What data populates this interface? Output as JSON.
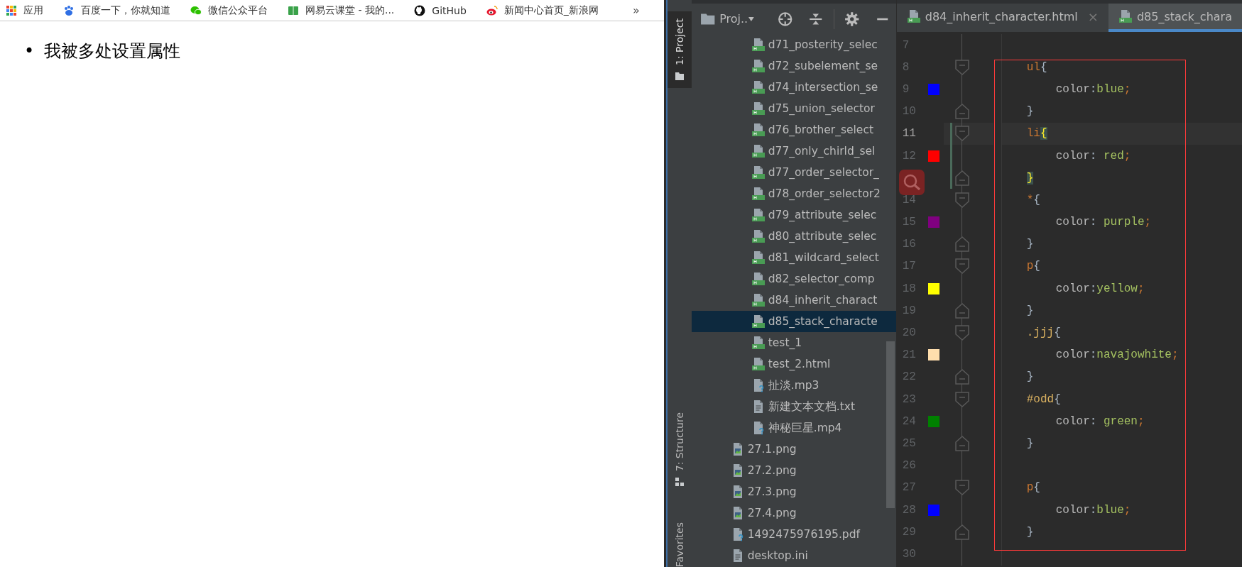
{
  "browser": {
    "bookmarks": [
      {
        "label": "应用",
        "kind": "apps"
      },
      {
        "label": "百度一下，你就知道",
        "kind": "paw"
      },
      {
        "label": "微信公众平台",
        "kind": "chat"
      },
      {
        "label": "网易云课堂 - 我的...",
        "kind": "book"
      },
      {
        "label": "GitHub",
        "kind": "github"
      },
      {
        "label": "新闻中心首页_新浪网",
        "kind": "weibo"
      }
    ],
    "overflow": "»",
    "list_items": [
      {
        "bullet": "•",
        "text": "我被多处设置属性"
      }
    ]
  },
  "ide": {
    "tool_tabs": [
      {
        "label": "1: Project",
        "selected": true,
        "kind": "project"
      },
      {
        "label": "7: Structure",
        "selected": false,
        "kind": "structure"
      },
      {
        "label": "Favorites",
        "selected": false,
        "kind": "favorites"
      }
    ],
    "project": {
      "title": "Proj..",
      "tree": [
        {
          "children": [
            {
              "label": "d71_posterity_selec",
              "kind": "html",
              "selected": false
            },
            {
              "label": "d72_subelement_se",
              "kind": "html",
              "selected": false
            },
            {
              "label": "d74_intersection_se",
              "kind": "html",
              "selected": false
            },
            {
              "label": "d75_union_selector",
              "kind": "html",
              "selected": false
            },
            {
              "label": "d76_brother_select",
              "kind": "html",
              "selected": false
            },
            {
              "label": "d77_only_chirld_sel",
              "kind": "html",
              "selected": false
            },
            {
              "label": "d77_order_selector_",
              "kind": "html",
              "selected": false
            },
            {
              "label": "d78_order_selector2",
              "kind": "html",
              "selected": false
            },
            {
              "label": "d79_attribute_selec",
              "kind": "html",
              "selected": false
            },
            {
              "label": "d80_attribute_selec",
              "kind": "html",
              "selected": false
            },
            {
              "label": "d81_wildcard_select",
              "kind": "html",
              "selected": false
            },
            {
              "label": "d82_selector_comp",
              "kind": "html",
              "selected": false
            },
            {
              "label": "d84_inherit_charact",
              "kind": "html",
              "selected": false
            },
            {
              "label": "d85_stack_characte",
              "kind": "html",
              "selected": true
            },
            {
              "label": "test_1",
              "kind": "html",
              "selected": false
            },
            {
              "label": "test_2.html",
              "kind": "html",
              "selected": false
            },
            {
              "label": "扯淡.mp3",
              "kind": "unknown",
              "selected": false
            },
            {
              "label": "新建文本文档.txt",
              "kind": "text",
              "selected": false
            },
            {
              "label": "神秘巨星.mp4",
              "kind": "unknown",
              "selected": false
            }
          ]
        },
        {
          "label": "27.1.png",
          "kind": "image",
          "selected": false
        },
        {
          "label": "27.2.png",
          "kind": "image",
          "selected": false
        },
        {
          "label": "27.3.png",
          "kind": "image",
          "selected": false
        },
        {
          "label": "27.4.png",
          "kind": "image",
          "selected": false
        },
        {
          "label": "1492475976195.pdf",
          "kind": "unknown",
          "selected": false
        },
        {
          "label": "desktop.ini",
          "kind": "text",
          "selected": false
        }
      ]
    },
    "editor_tabs": [
      {
        "label": "d84_inherit_character.html",
        "selected": false,
        "close": "×"
      },
      {
        "label": "d85_stack_chara",
        "selected": true
      }
    ],
    "lines": [
      {
        "num": "7",
        "kind": "blank",
        "fold_start": false,
        "fold_end": false,
        "current": false,
        "modified": false
      },
      {
        "num": "8",
        "kind": "selector",
        "fold_start": true,
        "fold_end": false,
        "current": false,
        "modified": false,
        "tokens": [
          {
            "text": "ul",
            "kind": "tag"
          },
          {
            "text": "{",
            "kind": "brace"
          }
        ]
      },
      {
        "num": "9",
        "kind": "decl",
        "color": "#0000ff",
        "fold_start": false,
        "fold_end": false,
        "current": false,
        "modified": false,
        "tokens": [
          {
            "text": "color",
            "kind": "prop"
          },
          {
            "text": ":",
            "kind": "punct"
          },
          {
            "text": "blue",
            "kind": "value"
          },
          {
            "text": ";",
            "kind": "semi"
          }
        ]
      },
      {
        "num": "10",
        "kind": "close",
        "fold_start": false,
        "fold_end": true,
        "current": false,
        "modified": false,
        "tokens": [
          {
            "text": "}",
            "kind": "brace"
          }
        ]
      },
      {
        "num": "11",
        "kind": "selector",
        "fold_start": true,
        "fold_end": false,
        "current": true,
        "modified": true,
        "tokens": [
          {
            "text": "li",
            "kind": "tag"
          },
          {
            "text": "{",
            "kind": "matched"
          }
        ]
      },
      {
        "num": "12",
        "kind": "decl",
        "color": "#ff0000",
        "fold_start": false,
        "fold_end": false,
        "current": false,
        "modified": true,
        "tokens": [
          {
            "text": "color",
            "kind": "prop"
          },
          {
            "text": ": ",
            "kind": "punct"
          },
          {
            "text": "red",
            "kind": "value"
          },
          {
            "text": ";",
            "kind": "semi"
          }
        ]
      },
      {
        "kind": "close",
        "fold_start": false,
        "fold_end": true,
        "current": false,
        "modified": true,
        "tokens": [
          {
            "text": "}",
            "kind": "matched"
          }
        ]
      },
      {
        "num": "14",
        "kind": "selector",
        "fold_start": true,
        "fold_end": false,
        "current": false,
        "modified": false,
        "tokens": [
          {
            "text": "*",
            "kind": "tag"
          },
          {
            "text": "{",
            "kind": "brace"
          }
        ]
      },
      {
        "num": "15",
        "kind": "decl",
        "color": "#800080",
        "fold_start": false,
        "fold_end": false,
        "current": false,
        "modified": false,
        "tokens": [
          {
            "text": "color",
            "kind": "prop"
          },
          {
            "text": ": ",
            "kind": "punct"
          },
          {
            "text": "purple",
            "kind": "value"
          },
          {
            "text": ";",
            "kind": "semi"
          }
        ]
      },
      {
        "num": "16",
        "kind": "close",
        "fold_start": false,
        "fold_end": true,
        "current": false,
        "modified": false,
        "tokens": [
          {
            "text": "}",
            "kind": "brace"
          }
        ]
      },
      {
        "num": "17",
        "kind": "selector",
        "fold_start": true,
        "fold_end": false,
        "current": false,
        "modified": false,
        "tokens": [
          {
            "text": "p",
            "kind": "tag"
          },
          {
            "text": "{",
            "kind": "brace"
          }
        ]
      },
      {
        "num": "18",
        "kind": "decl",
        "color": "#ffff00",
        "fold_start": false,
        "fold_end": false,
        "current": false,
        "modified": false,
        "tokens": [
          {
            "text": "color",
            "kind": "prop"
          },
          {
            "text": ":",
            "kind": "punct"
          },
          {
            "text": "yellow",
            "kind": "value"
          },
          {
            "text": ";",
            "kind": "semi"
          }
        ]
      },
      {
        "num": "19",
        "kind": "close",
        "fold_start": false,
        "fold_end": true,
        "current": false,
        "modified": false,
        "tokens": [
          {
            "text": "}",
            "kind": "brace"
          }
        ]
      },
      {
        "num": "20",
        "kind": "selector",
        "fold_start": true,
        "fold_end": false,
        "current": false,
        "modified": false,
        "tokens": [
          {
            "text": ".jjj",
            "kind": "class"
          },
          {
            "text": "{",
            "kind": "brace"
          }
        ]
      },
      {
        "num": "21",
        "kind": "decl",
        "color": "#ffdead",
        "fold_start": false,
        "fold_end": false,
        "current": false,
        "modified": false,
        "tokens": [
          {
            "text": "color",
            "kind": "prop"
          },
          {
            "text": ":",
            "kind": "punct"
          },
          {
            "text": "navajowhite",
            "kind": "value"
          },
          {
            "text": ";",
            "kind": "semi"
          }
        ]
      },
      {
        "num": "22",
        "kind": "close",
        "fold_start": false,
        "fold_end": true,
        "current": false,
        "modified": false,
        "tokens": [
          {
            "text": "}",
            "kind": "brace"
          }
        ]
      },
      {
        "num": "23",
        "kind": "selector",
        "fold_start": true,
        "fold_end": false,
        "current": false,
        "modified": false,
        "tokens": [
          {
            "text": "#odd",
            "kind": "class"
          },
          {
            "text": "{",
            "kind": "brace"
          }
        ]
      },
      {
        "num": "24",
        "kind": "decl",
        "color": "#008000",
        "fold_start": false,
        "fold_end": false,
        "current": false,
        "modified": false,
        "tokens": [
          {
            "text": "color",
            "kind": "prop"
          },
          {
            "text": ": ",
            "kind": "punct"
          },
          {
            "text": "green",
            "kind": "value"
          },
          {
            "text": ";",
            "kind": "semi"
          }
        ]
      },
      {
        "num": "25",
        "kind": "close",
        "fold_start": false,
        "fold_end": true,
        "current": false,
        "modified": false,
        "tokens": [
          {
            "text": "}",
            "kind": "brace"
          }
        ]
      },
      {
        "num": "26",
        "kind": "blank",
        "fold_start": false,
        "fold_end": false,
        "current": false,
        "modified": false
      },
      {
        "num": "27",
        "kind": "selector",
        "fold_start": true,
        "fold_end": false,
        "current": false,
        "modified": false,
        "tokens": [
          {
            "text": "p",
            "kind": "tag"
          },
          {
            "text": "{",
            "kind": "brace"
          }
        ]
      },
      {
        "num": "28",
        "kind": "decl",
        "color": "#0000ff",
        "fold_start": false,
        "fold_end": false,
        "current": false,
        "modified": false,
        "tokens": [
          {
            "text": "color",
            "kind": "prop"
          },
          {
            "text": ":",
            "kind": "punct"
          },
          {
            "text": "blue",
            "kind": "value"
          },
          {
            "text": ";",
            "kind": "semi"
          }
        ]
      },
      {
        "num": "29",
        "kind": "close",
        "fold_start": false,
        "fold_end": true,
        "current": false,
        "modified": false,
        "tokens": [
          {
            "text": "}",
            "kind": "brace"
          }
        ]
      },
      {
        "num": "30",
        "kind": "blank",
        "fold_start": false,
        "fold_end": false,
        "current": false,
        "modified": false
      }
    ]
  }
}
